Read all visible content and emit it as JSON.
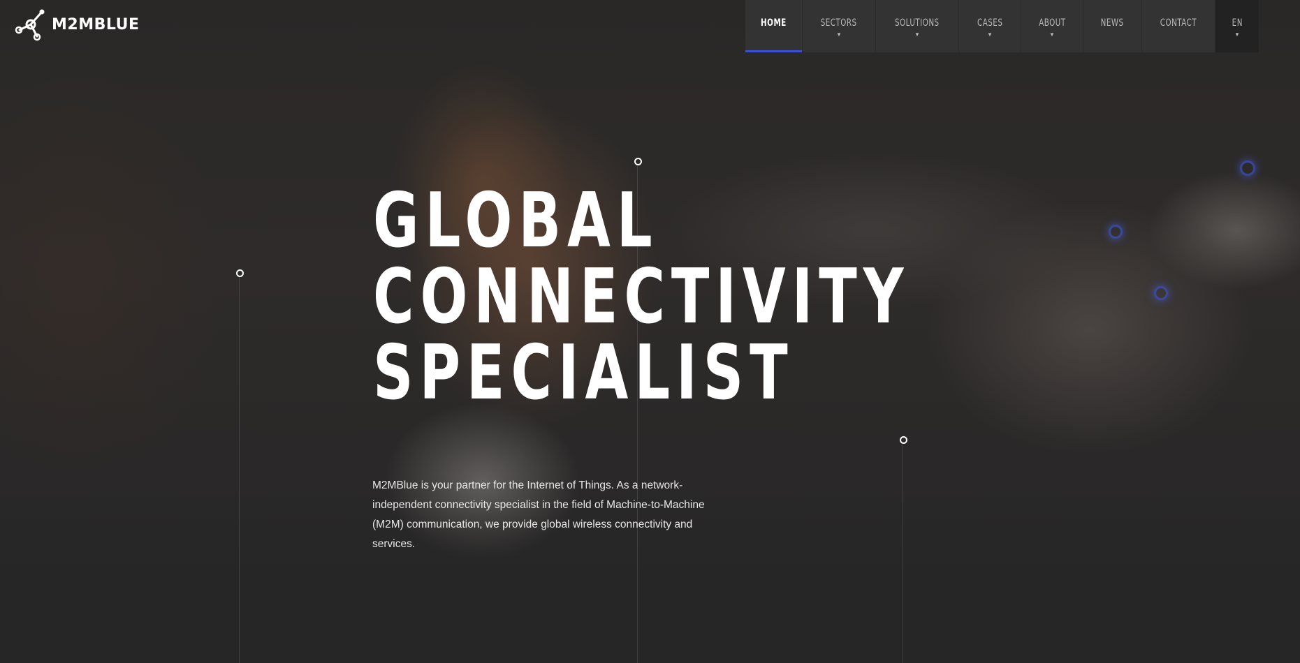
{
  "logo": {
    "text": "M2MBLUE",
    "icon": "molecule-node-icon"
  },
  "nav": {
    "items": [
      {
        "label": "HOME",
        "active": true,
        "has_dropdown": false
      },
      {
        "label": "SECTORS",
        "active": false,
        "has_dropdown": true
      },
      {
        "label": "SOLUTIONS",
        "active": false,
        "has_dropdown": true
      },
      {
        "label": "CASES",
        "active": false,
        "has_dropdown": true
      },
      {
        "label": "ABOUT",
        "active": false,
        "has_dropdown": true
      },
      {
        "label": "NEWS",
        "active": false,
        "has_dropdown": false
      },
      {
        "label": "CONTACT",
        "active": false,
        "has_dropdown": false
      }
    ],
    "language": {
      "label": "EN",
      "has_dropdown": true
    },
    "caret_glyph": "▼"
  },
  "hero": {
    "headline_lines": [
      "GLOBAL",
      "CONNECTIVITY",
      "SPECIALIST"
    ],
    "intro": "M2MBlue is your partner for the Internet of Things. As a network-independent connectivity specialist in the field of Machine-to-Machine (M2M) communication, we provide global wireless connectivity and services."
  },
  "colors": {
    "accent": "#3d4fd6",
    "background": "#262626",
    "nav_background": "#333333",
    "text": "#ffffff"
  }
}
